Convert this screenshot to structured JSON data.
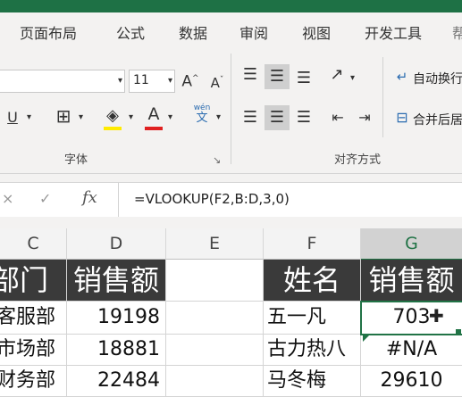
{
  "ribbon": {
    "tabs": [
      "页面布局",
      "公式",
      "数据",
      "审阅",
      "视图",
      "开发工具"
    ],
    "font_size": "11",
    "wrap_text_label": "自动换行",
    "merge_label": "合并后居中",
    "phonetic_label_top": "wén",
    "phonetic_label_bottom": "文",
    "group_font": "字体",
    "group_align": "对齐方式",
    "font_grow_glyph": "A",
    "font_shrink_glyph": "A",
    "underline_glyph": "U",
    "font_color_glyph": "A"
  },
  "formula_bar": {
    "fx_label": "fx",
    "formula": "=VLOOKUP(F2,B:D,3,0)"
  },
  "sheet": {
    "columns": [
      "C",
      "D",
      "E",
      "F",
      "G"
    ],
    "left_table": {
      "headers": [
        "部门",
        "销售额"
      ],
      "rows": [
        [
          "客服部",
          "19198"
        ],
        [
          "市场部",
          "18881"
        ],
        [
          "财务部",
          "22484"
        ]
      ]
    },
    "right_table": {
      "headers": [
        "姓名",
        "销售额"
      ],
      "rows": [
        [
          "五一凡",
          "703"
        ],
        [
          "古力热八",
          "#N/A"
        ],
        [
          "马冬梅",
          "29610"
        ]
      ]
    }
  },
  "colors": {
    "ribbon_accent": "#1e7145",
    "header_fill": "#3a3a3a",
    "selection_border": "#217346"
  }
}
